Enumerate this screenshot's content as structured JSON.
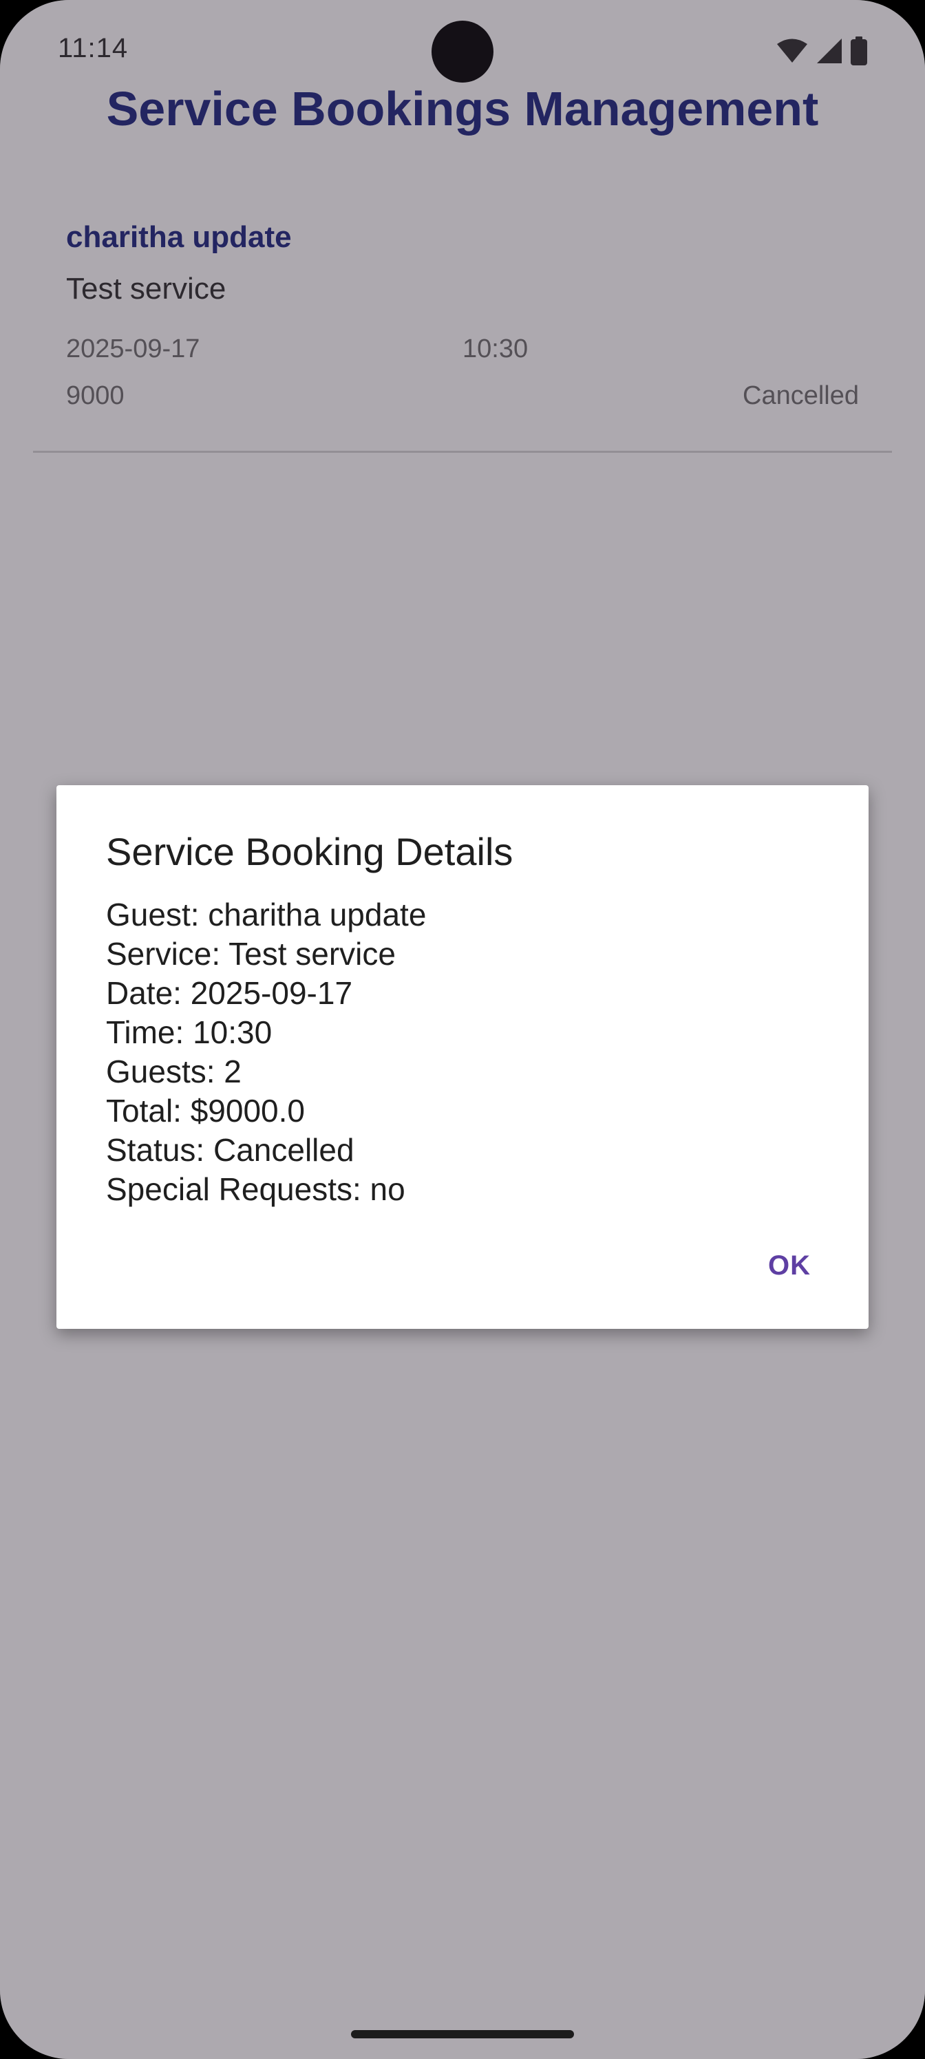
{
  "status_bar": {
    "time": "11:14",
    "icons": [
      "wifi-icon",
      "cellular-signal-icon",
      "battery-icon"
    ]
  },
  "page": {
    "title": "Service Bookings Management"
  },
  "bookings": [
    {
      "guest": "charitha update",
      "service": "Test service",
      "date": "2025-09-17",
      "time": "10:30",
      "total": "9000",
      "status": "Cancelled"
    }
  ],
  "dialog": {
    "title": "Service Booking Details",
    "lines": [
      "Guest: charitha update",
      "Service: Test service",
      "Date: 2025-09-17",
      "Time: 10:30",
      "Guests: 2",
      "Total: $9000.0",
      "Status: Cancelled",
      "Special Requests: no"
    ],
    "ok_label": "OK"
  },
  "colors": {
    "title": "#1a237e",
    "accent": "#5e3fa3",
    "scrim": "#a9a5ab"
  }
}
